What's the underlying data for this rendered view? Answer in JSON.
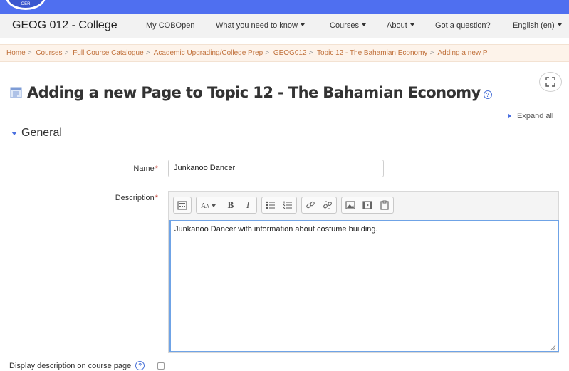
{
  "logo": {
    "text": "OER"
  },
  "navbar": {
    "brand": "GEOG 012 - College",
    "items": [
      {
        "label": "My COBOpen",
        "dropdown": false
      },
      {
        "label": "What you need to know",
        "dropdown": true
      },
      {
        "label": "Courses",
        "dropdown": true
      },
      {
        "label": "About",
        "dropdown": true
      },
      {
        "label": "Got a question?",
        "dropdown": false
      },
      {
        "label": "English (en)",
        "dropdown": true
      }
    ]
  },
  "breadcrumb": [
    "Home",
    "Courses",
    "Full Course Catalogue",
    "Academic Upgrading/College Prep",
    "GEOG012",
    "Topic 12 - The Bahamian Economy",
    "Adding a new P"
  ],
  "page": {
    "title": "Adding a new Page to Topic 12 - The Bahamian Economy",
    "expand_all": "Expand all"
  },
  "section": {
    "title": "General"
  },
  "form": {
    "name_label": "Name",
    "name_value": "Junkanoo Dancer",
    "description_label": "Description",
    "description_value": "Junkanoo Dancer with information about costume building.",
    "display_label": "Display description on course page",
    "display_checked": false
  },
  "toolbar": {
    "bold": "B",
    "italic": "I"
  },
  "colors": {
    "topstrip": "#4f6ff0",
    "breadcrumb_bg": "#fdf3ea",
    "breadcrumb_link": "#c0703a",
    "required": "#c0392b",
    "editor_focus": "#6fa3e6"
  }
}
